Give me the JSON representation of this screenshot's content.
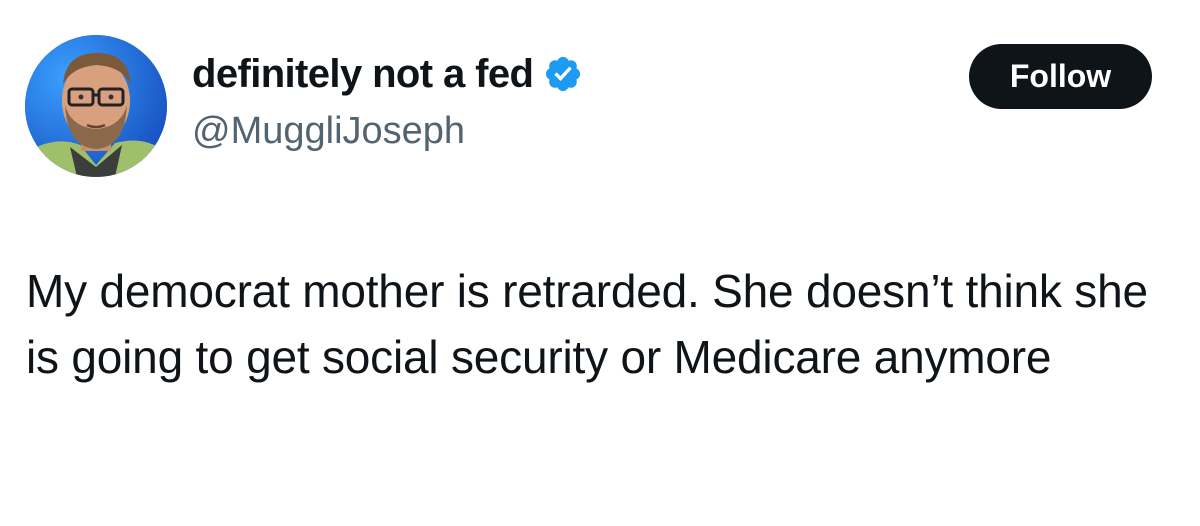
{
  "author": {
    "display_name": "definitely not a fed",
    "handle": "@MuggliJoseph",
    "verified": true,
    "avatar_icon": "profile-photo"
  },
  "actions": {
    "follow_label": "Follow"
  },
  "tweet": {
    "text": "My democrat mother is retrarded.  She doesn’t think she is going to get social security or Medicare anymore"
  },
  "colors": {
    "text_primary": "#0f1419",
    "text_secondary": "#536471",
    "verified_blue": "#1d9bf0",
    "follow_button_bg": "#0f1419"
  }
}
